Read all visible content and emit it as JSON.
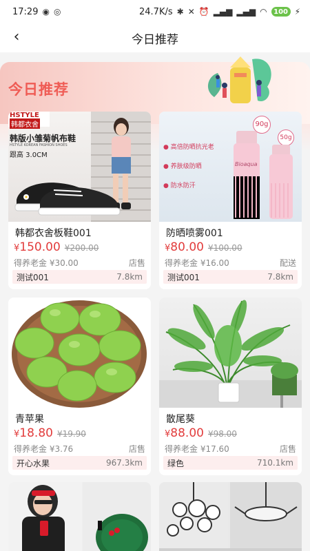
{
  "status_bar": {
    "time": "17:29",
    "speed": "24.7K/s",
    "battery": "100"
  },
  "nav": {
    "title": "今日推荐"
  },
  "hero": {
    "title": "今日推荐"
  },
  "products": [
    {
      "name": "韩都衣舍板鞋001",
      "price_symbol": "¥",
      "price": "150.00",
      "old_price": "¥200.00",
      "pension_label": "得养老金 ¥30.00",
      "tag": "店售",
      "store": "测试001",
      "distance": "7.8km",
      "image": {
        "brand": "HSTYLE",
        "brand_cn": "韩都衣舍",
        "headline": "韩版小雏菊帆布鞋",
        "subline": "HSTYLE KOREAN FASHION SHOES",
        "heel": "跟高 3.0CM"
      }
    },
    {
      "name": "防晒喷雾001",
      "price_symbol": "¥",
      "price": "80.00",
      "old_price": "¥100.00",
      "pension_label": "得养老金 ¥16.00",
      "tag": "配送",
      "store": "测试001",
      "distance": "7.8km",
      "image": {
        "big_badge": "90g",
        "small_badge": "50g",
        "features": [
          "高倍防晒抗光老",
          "养肤级防晒",
          "防水防汗"
        ],
        "brand_script": "Bioaqua"
      }
    },
    {
      "name": "青苹果",
      "price_symbol": "¥",
      "price": "18.80",
      "old_price": "¥19.90",
      "pension_label": "得养老金 ¥3.76",
      "tag": "店售",
      "store": "开心水果",
      "distance": "967.3km"
    },
    {
      "name": "散尾葵",
      "price_symbol": "¥",
      "price": "88.00",
      "old_price": "¥98.00",
      "pension_label": "得养老金 ¥17.60",
      "tag": "店售",
      "store": "绿色",
      "distance": "710.1km"
    }
  ],
  "colors": {
    "accent": "#ef5c55",
    "price": "#e23c3c",
    "store_bg": "#fdeeee"
  }
}
